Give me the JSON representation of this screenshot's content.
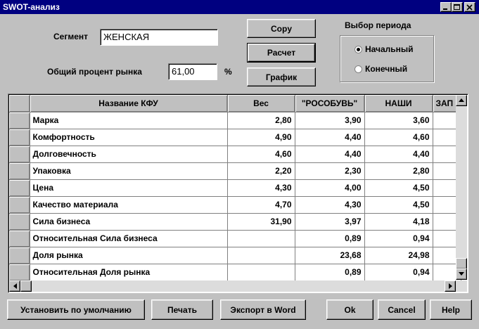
{
  "window": {
    "title": "SWOT-анализ",
    "buttons": [
      "minimize",
      "maximize",
      "close"
    ]
  },
  "segment": {
    "label": "Сегмент",
    "value": "ЖЕНСКАЯ"
  },
  "market": {
    "label": "Общий процент рынка",
    "value": "61,00",
    "unit": "%"
  },
  "actions": {
    "copy": "Copy",
    "calc": "Расчет",
    "graph": "График"
  },
  "period": {
    "title": "Выбор периода",
    "options": [
      {
        "label": "Начальный",
        "checked": true
      },
      {
        "label": "Конечный",
        "checked": false
      }
    ]
  },
  "table": {
    "columns": [
      "Название КФУ",
      "Вес",
      "\"РОСОБУВЬ\"",
      "НАШИ",
      "ЗАП"
    ],
    "rows": [
      [
        "Марка",
        "2,80",
        "3,90",
        "3,60",
        ""
      ],
      [
        "Комфортность",
        "4,90",
        "4,40",
        "4,60",
        ""
      ],
      [
        "Долговечность",
        "4,60",
        "4,40",
        "4,40",
        ""
      ],
      [
        "Упаковка",
        "2,20",
        "2,30",
        "2,80",
        ""
      ],
      [
        "Цена",
        "4,30",
        "4,00",
        "4,50",
        ""
      ],
      [
        "Качество материала",
        "4,70",
        "4,30",
        "4,50",
        ""
      ],
      [
        "Сила бизнеса",
        "31,90",
        "3,97",
        "4,18",
        ""
      ],
      [
        "Относительная Сила бизнеса",
        "",
        "0,89",
        "0,94",
        ""
      ],
      [
        "Доля рынка",
        "",
        "23,68",
        "24,98",
        ""
      ],
      [
        "Относительная Доля рынка",
        "",
        "0,89",
        "0,94",
        ""
      ]
    ]
  },
  "footer": {
    "defaults": "Установить по умолчанию",
    "print": "Печать",
    "export": "Экспорт в Word",
    "ok": "Ok",
    "cancel": "Cancel",
    "help": "Help"
  },
  "colors": {
    "titlebar": "#000080",
    "face": "#c0c0c0"
  }
}
